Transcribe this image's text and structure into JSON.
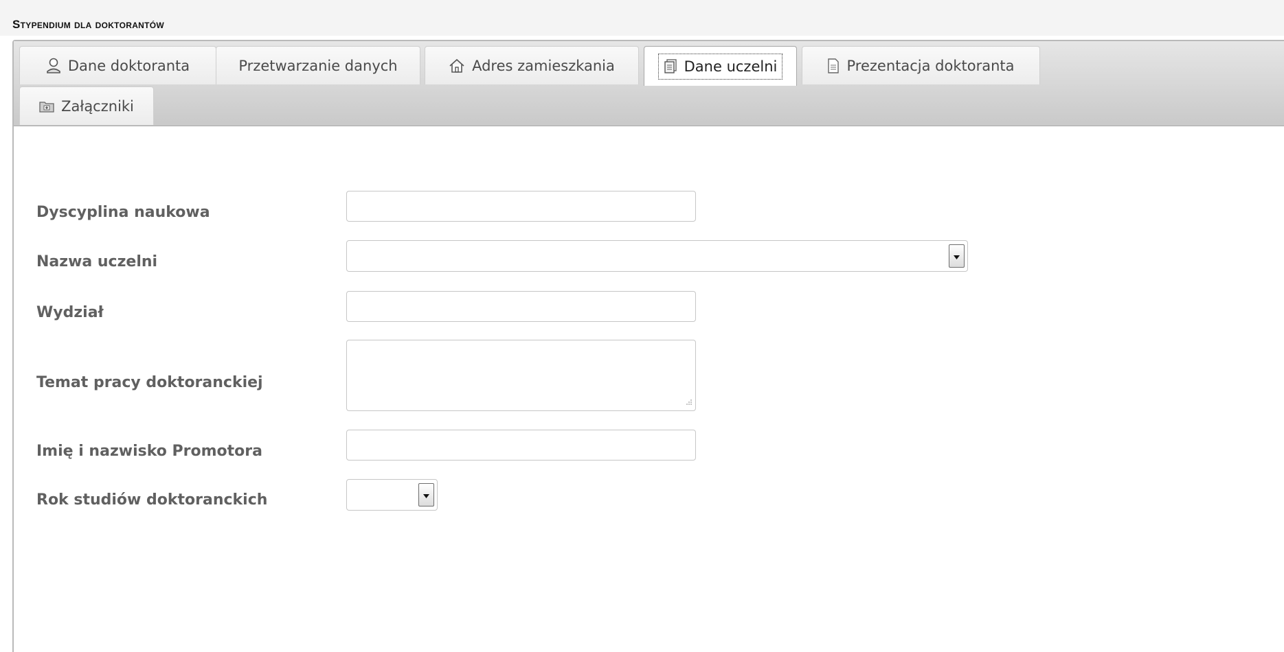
{
  "page": {
    "title": "Stypendium dla doktorantów"
  },
  "tabs": [
    {
      "label": "Dane doktoranta",
      "icon": "user-icon",
      "active": false
    },
    {
      "label": "Przetwarzanie danych",
      "icon": "",
      "active": false
    },
    {
      "label": "Adres zamieszkania",
      "icon": "home-icon",
      "active": false
    },
    {
      "label": "Dane uczelni",
      "icon": "document-stack-icon",
      "active": true
    },
    {
      "label": "Prezentacja doktoranta",
      "icon": "document-icon",
      "active": false
    },
    {
      "label": "Załączniki",
      "icon": "folder-icon",
      "active": false
    }
  ],
  "form": {
    "dyscyplina": {
      "label": "Dyscyplina naukowa",
      "value": ""
    },
    "uczelnia": {
      "label": "Nazwa uczelni",
      "value": ""
    },
    "wydzial": {
      "label": "Wydział",
      "value": ""
    },
    "temat": {
      "label": "Temat pracy doktoranckiej",
      "value": ""
    },
    "promotor": {
      "label": "Imię i nazwisko Promotora",
      "value": ""
    },
    "rok": {
      "label": "Rok studiów doktoranckich",
      "value": ""
    }
  }
}
